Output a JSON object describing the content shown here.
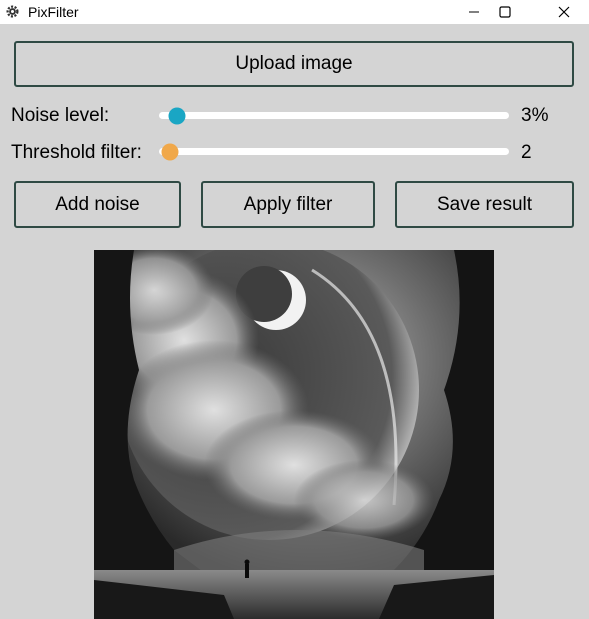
{
  "window": {
    "title": "PixFilter"
  },
  "toolbar": {
    "upload_label": "Upload image"
  },
  "noise": {
    "label": "Noise level:",
    "value_text": "3%",
    "fraction": 0.05
  },
  "threshold": {
    "label": "Threshold filter:",
    "value_text": "2",
    "fraction": 0.03
  },
  "actions": {
    "add_noise": "Add noise",
    "apply_filter": "Apply filter",
    "save_result": "Save result"
  },
  "colors": {
    "noise_thumb": "#1aa6c4",
    "threshold_thumb": "#f0a84a",
    "button_border": "#2f4a44",
    "background": "#d4d4d4"
  },
  "icons": {
    "app": "gear-icon",
    "minimize": "minimize-icon",
    "maximize": "maximize-icon",
    "close": "close-icon"
  }
}
